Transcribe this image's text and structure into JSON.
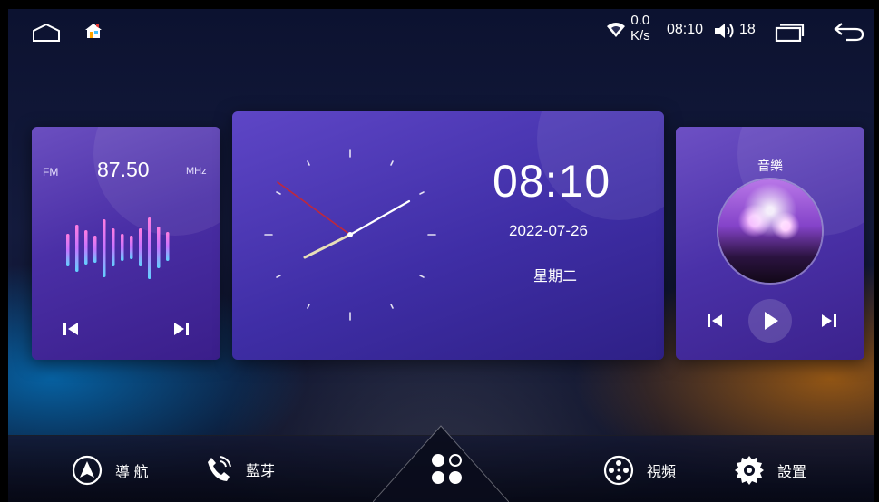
{
  "status_bar": {
    "net_speed_value": "0.0",
    "net_speed_unit": "K/s",
    "time": "08:10",
    "volume": "18"
  },
  "radio": {
    "band": "FM",
    "frequency": "87.50",
    "unit": "MHz"
  },
  "clock": {
    "time": "08:10",
    "date": "2022-07-26",
    "weekday": "星期二"
  },
  "music": {
    "title": "音樂"
  },
  "dock": {
    "navigation": "導 航",
    "bluetooth": "藍芽",
    "video": "視頻",
    "settings": "設置"
  },
  "colors": {
    "accent_purple": "#4a2fa6",
    "background": "#0c1230",
    "text": "#ffffff"
  }
}
